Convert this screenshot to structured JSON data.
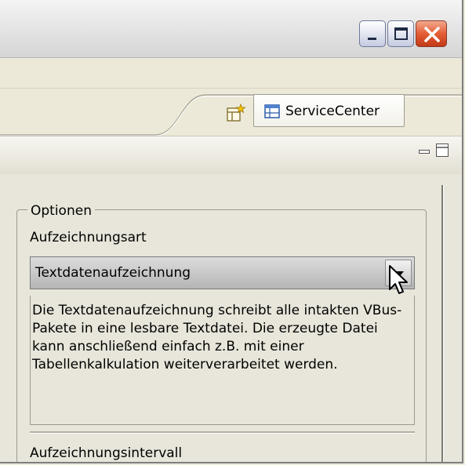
{
  "window": {
    "buttons": {
      "minimize": "minimize",
      "maximize": "maximize",
      "close": "close"
    }
  },
  "perspective": {
    "open_icon": "open-perspective-icon",
    "button_icon": "table-grid-icon",
    "label": "ServiceCenter"
  },
  "view": {
    "controls": {
      "minimize": "view-minimize-icon",
      "maximize": "view-maximize-icon"
    }
  },
  "options": {
    "group_label": "Optionen",
    "recording_type_label": "Aufzeichnungsart",
    "recording_type_value": "Textdatenaufzeichnung",
    "description": "Die Textdatenaufzeichnung schreibt alle intakten VBus-Pakete in eine lesbare Textdatei. Die erzeugte Datei kann anschließend einfach z.B. mit einer Tabellenkalkulation weiterverarbeitet werden.",
    "recording_interval_label": "Aufzeichnungsintervall"
  },
  "colors": {
    "close_button": "#e45d36",
    "window_background": "#ece9d8",
    "combo_background": "#c8c8c8"
  }
}
